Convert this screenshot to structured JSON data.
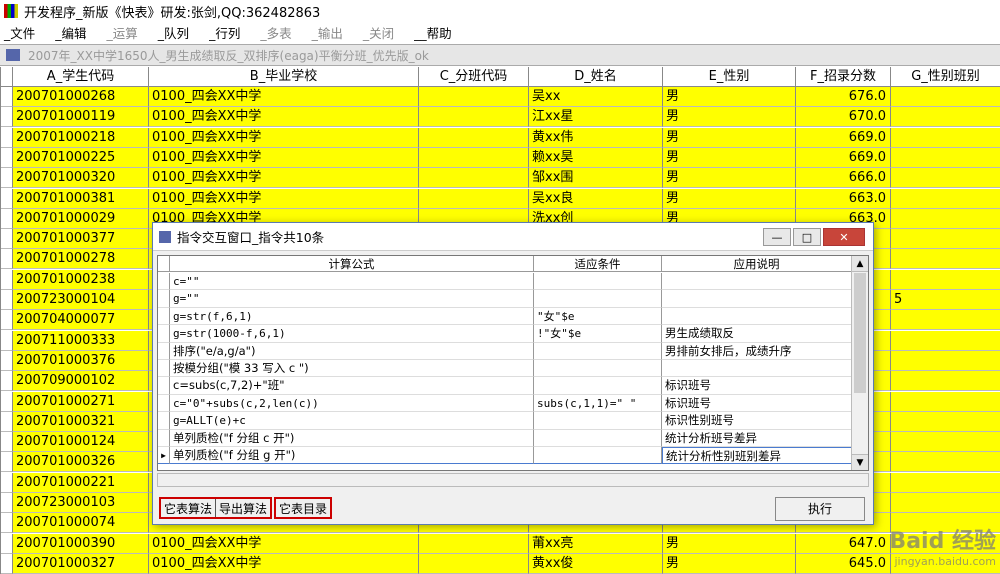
{
  "app": {
    "title": "开发程序_新版《快表》研发:张剑,QQ:362482863"
  },
  "menu": [
    {
      "label": "_文件",
      "enabled": true
    },
    {
      "label": "_编辑",
      "enabled": true
    },
    {
      "label": "_运算",
      "enabled": false
    },
    {
      "label": "_队列",
      "enabled": true
    },
    {
      "label": "_行列",
      "enabled": true
    },
    {
      "label": "_多表",
      "enabled": false
    },
    {
      "label": "_输出",
      "enabled": false
    },
    {
      "label": "_关闭",
      "enabled": false
    },
    {
      "label": "__帮助",
      "enabled": true
    }
  ],
  "document": {
    "title": "2007年_XX中学1650人_男生成绩取反_双排序(eaga)平衡分班_优先版_ok"
  },
  "grid": {
    "columns": [
      "A_学生代码",
      "B_毕业学校",
      "C_分班代码",
      "D_姓名",
      "E_性别",
      "F_招录分数",
      "G_性别班别"
    ],
    "rows": [
      [
        "200701000268",
        "0100_四会XX中学",
        "",
        "吴xx",
        "男",
        "676.0",
        ""
      ],
      [
        "200701000119",
        "0100_四会XX中学",
        "",
        "江xx星",
        "男",
        "670.0",
        ""
      ],
      [
        "200701000218",
        "0100_四会XX中学",
        "",
        "黄xx伟",
        "男",
        "669.0",
        ""
      ],
      [
        "200701000225",
        "0100_四会XX中学",
        "",
        "赖xx昊",
        "男",
        "669.0",
        ""
      ],
      [
        "200701000320",
        "0100_四会XX中学",
        "",
        "邹xx围",
        "男",
        "666.0",
        ""
      ],
      [
        "200701000381",
        "0100_四会XX中学",
        "",
        "吴xx良",
        "男",
        "663.0",
        ""
      ],
      [
        "200701000029",
        "0100_四会XX中学",
        "",
        "洗xx创",
        "男",
        "663.0",
        ""
      ],
      [
        "200701000377",
        "",
        "",
        "",
        "",
        "",
        ""
      ],
      [
        "200701000278",
        "",
        "",
        "",
        "",
        "",
        ""
      ],
      [
        "200701000238",
        "",
        "",
        "",
        "",
        "",
        ""
      ],
      [
        "200723000104",
        "",
        "",
        "",
        "",
        "",
        "5"
      ],
      [
        "200704000077",
        "",
        "",
        "",
        "",
        "",
        ""
      ],
      [
        "200711000333",
        "",
        "",
        "",
        "",
        "",
        ""
      ],
      [
        "200701000376",
        "",
        "",
        "",
        "",
        "",
        ""
      ],
      [
        "200709000102",
        "",
        "",
        "",
        "",
        "",
        ""
      ],
      [
        "200701000271",
        "",
        "",
        "",
        "",
        "",
        ""
      ],
      [
        "200701000321",
        "",
        "",
        "",
        "",
        "",
        ""
      ],
      [
        "200701000124",
        "",
        "",
        "",
        "",
        "",
        ""
      ],
      [
        "200701000326",
        "",
        "",
        "",
        "",
        "",
        ""
      ],
      [
        "200701000221",
        "",
        "",
        "",
        "",
        "",
        ""
      ],
      [
        "200723000103",
        "",
        "",
        "",
        "",
        "",
        ""
      ],
      [
        "200701000074",
        "",
        "",
        "",
        "",
        "",
        ""
      ],
      [
        "200701000390",
        "0100_四会XX中学",
        "",
        "莆xx亮",
        "男",
        "647.0",
        ""
      ],
      [
        "200701000327",
        "0100_四会XX中学",
        "",
        "黄xx俊",
        "男",
        "645.0",
        ""
      ]
    ]
  },
  "dialog": {
    "title": "指令交互窗口_指令共10条",
    "headers": [
      "计算公式",
      "适应条件",
      "应用说明"
    ],
    "rows": [
      [
        "c=\"\"",
        "",
        ""
      ],
      [
        "g=\"\"",
        "",
        ""
      ],
      [
        "g=str(f,6,1)",
        "\"女\"$e",
        ""
      ],
      [
        "g=str(1000-f,6,1)",
        "!\"女\"$e",
        "男生成绩取反"
      ],
      [
        "排序(\"e/a,g/a\")",
        "",
        "男排前女排后，成绩升序"
      ],
      [
        "按模分组(\"模 33 写入 c \")",
        "",
        ""
      ],
      [
        "c=subs(c,7,2)+\"班\"",
        "",
        "标识班号"
      ],
      [
        "c=\"0\"+subs(c,2,len(c))",
        "subs(c,1,1)=\" \"",
        "标识班号"
      ],
      [
        "g=ALLT(e)+c",
        "",
        "标识性别班号"
      ],
      [
        "单列质检(\"f 分组 c 开\")",
        "",
        "统计分析班号差异"
      ],
      [
        "单列质检(\"f 分组 g 开\")",
        "",
        "统计分析性别班别差异"
      ]
    ],
    "active_row": 10,
    "buttons": [
      "它表算法",
      "导出算法",
      "它表目录"
    ],
    "execute_label": "执行",
    "window_buttons": [
      "—",
      "□",
      "✕"
    ]
  },
  "watermark": {
    "main": "Baid 经验",
    "sub": "jingyan.baidu.com"
  }
}
